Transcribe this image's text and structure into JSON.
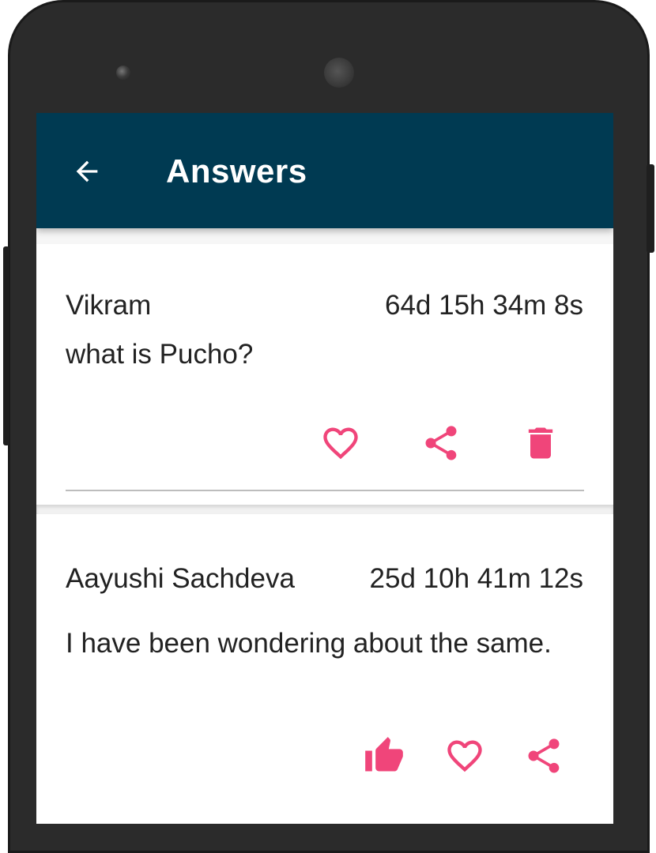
{
  "appbar": {
    "title": "Answers",
    "back_icon": "arrow-back-icon"
  },
  "answers": [
    {
      "author": "Vikram",
      "time": "64d 15h 34m 8s",
      "text": "what is Pucho?",
      "actions": [
        "heart-outline-icon",
        "share-icon",
        "trash-icon"
      ]
    },
    {
      "author": "Aayushi Sachdeva",
      "time": "25d 10h 41m 12s",
      "text": "I have been wondering about the same.",
      "actions": [
        "thumbs-up-icon",
        "heart-outline-icon",
        "share-icon"
      ]
    }
  ],
  "colors": {
    "appbar": "#003a52",
    "accent": "#f0457a",
    "text": "#222222",
    "phone_body": "#2b2b2b"
  }
}
